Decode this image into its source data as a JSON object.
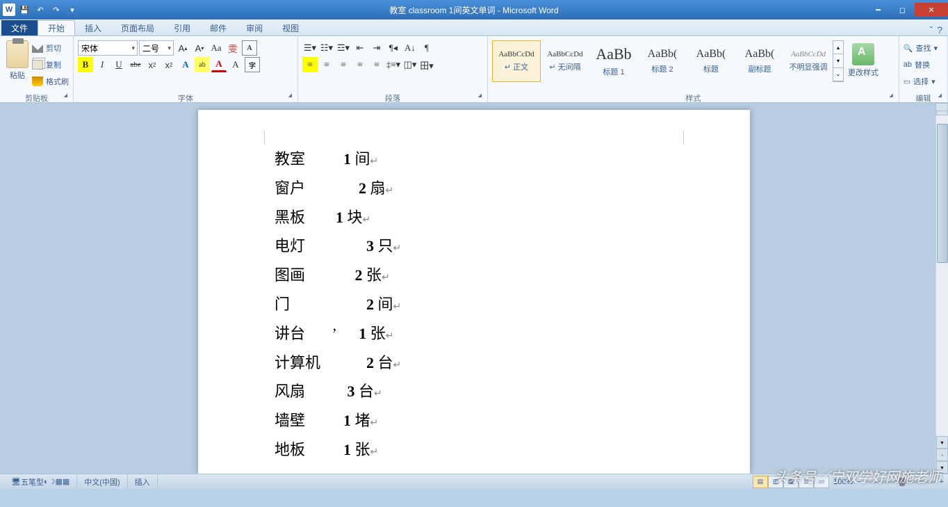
{
  "title": "教室    classroom  1间英文单词 - Microsoft Word",
  "qat": {
    "save": "💾",
    "undo": "↶",
    "redo": "↷"
  },
  "tabs": {
    "file": "文件",
    "items": [
      "开始",
      "插入",
      "页面布局",
      "引用",
      "邮件",
      "审阅",
      "视图"
    ],
    "active": 0
  },
  "clipboard": {
    "paste": "粘贴",
    "cut": "剪切",
    "copy": "复制",
    "brush": "格式刷",
    "label": "剪贴板"
  },
  "font": {
    "name": "宋体",
    "size": "二号",
    "grow": "A",
    "shrink": "A",
    "case": "Aa",
    "clear": "A",
    "bold": "B",
    "italic": "I",
    "under": "U",
    "strike": "abe",
    "sub": "x",
    "sup": "x",
    "effects": "A",
    "highlight": "ab",
    "color": "A",
    "phonetic": "雯",
    "border": "A",
    "label": "字体"
  },
  "para": {
    "label": "段落",
    "bullets": "≡",
    "numbers": "≡",
    "multilevel": "≡",
    "dec": "≤",
    "inc": "≥",
    "sort": "A↓",
    "marks": "¶",
    "al": "≡",
    "ac": "≡",
    "ar": "≡",
    "aj": "≡",
    "ad": "≡",
    "ls": "≡",
    "shade": "◫",
    "border": "田"
  },
  "styles": {
    "label": "样式",
    "items": [
      {
        "prev": "AaBbCcDd",
        "name": "↵ 正文",
        "sel": true
      },
      {
        "prev": "AaBbCcDd",
        "name": "↵ 无间隔"
      },
      {
        "prev": "AaBb",
        "name": "标题 1",
        "big": true
      },
      {
        "prev": "AaBb(",
        "name": "标题 2",
        "mid": true
      },
      {
        "prev": "AaBb(",
        "name": "标题",
        "mid": true
      },
      {
        "prev": "AaBb(",
        "name": "副标题",
        "mid": true
      },
      {
        "prev": "AaBbCcDd",
        "name": "不明显强调",
        "ital": true
      }
    ],
    "change": "更改样式"
  },
  "edit": {
    "find": "查找",
    "replace": "替换",
    "select": "选择",
    "label": "编辑"
  },
  "document": {
    "lines": [
      {
        "t1": "教室",
        "sp": "          ",
        "n": "1",
        "t2": " 间"
      },
      {
        "t1": "窗户",
        "sp": "              ",
        "n": "2",
        "t2": " 扇"
      },
      {
        "t1": "黑板",
        "sp": "        ",
        "n": "1",
        "t2": " 块"
      },
      {
        "t1": "电灯",
        "sp": "                ",
        "n": "3",
        "t2": " 只"
      },
      {
        "t1": "图画",
        "sp": "             ",
        "n": "2",
        "t2": " 张"
      },
      {
        "t1": "门",
        "sp": "                    ",
        "n": "2",
        "t2": " 间"
      },
      {
        "t1": "讲台",
        "sp": "       ’      ",
        "n": "1",
        "t2": " 张"
      },
      {
        "t1": "计算机",
        "sp": "            ",
        "n": "2",
        "t2": " 台"
      },
      {
        "t1": "风扇",
        "sp": "           ",
        "n": "3",
        "t2": " 台"
      },
      {
        "t1": "墙壁",
        "sp": "          ",
        "n": "1",
        "t2": " 堵"
      },
      {
        "t1": "地板",
        "sp": "          ",
        "n": "1",
        "t2": " 张"
      }
    ]
  },
  "status": {
    "lang": "中文(中国)",
    "mode": "插入",
    "zoom": "100%",
    "ime": "五笔型"
  },
  "watermark": "头条号／宁双学好网施老师"
}
